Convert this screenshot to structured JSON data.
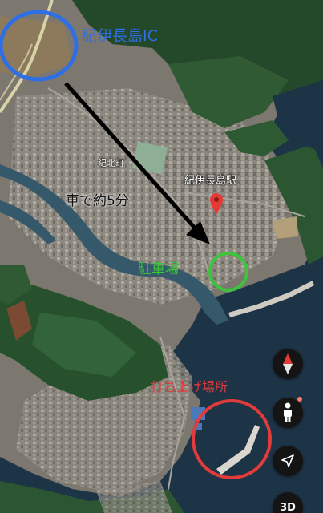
{
  "map": {
    "labels": {
      "interchange": "紀伊長島IC",
      "district": "紀北町",
      "station": "紀伊長島駅",
      "drive_time": "車で約5分",
      "parking": "駐車場",
      "launch_site": "打ち上げ場所"
    },
    "colors": {
      "interchange_circle": "#2e6fe6",
      "parking_circle": "#3dc43d",
      "launch_circle": "#e23b3b",
      "arrow": "#000000",
      "station_pin": "#e53935",
      "sea": "#1d3346"
    }
  },
  "controls": {
    "compass_icon": "compass-icon",
    "person_icon": "street-view-person-icon",
    "location_icon": "location-arrow-icon",
    "view_3d_label": "3D"
  }
}
